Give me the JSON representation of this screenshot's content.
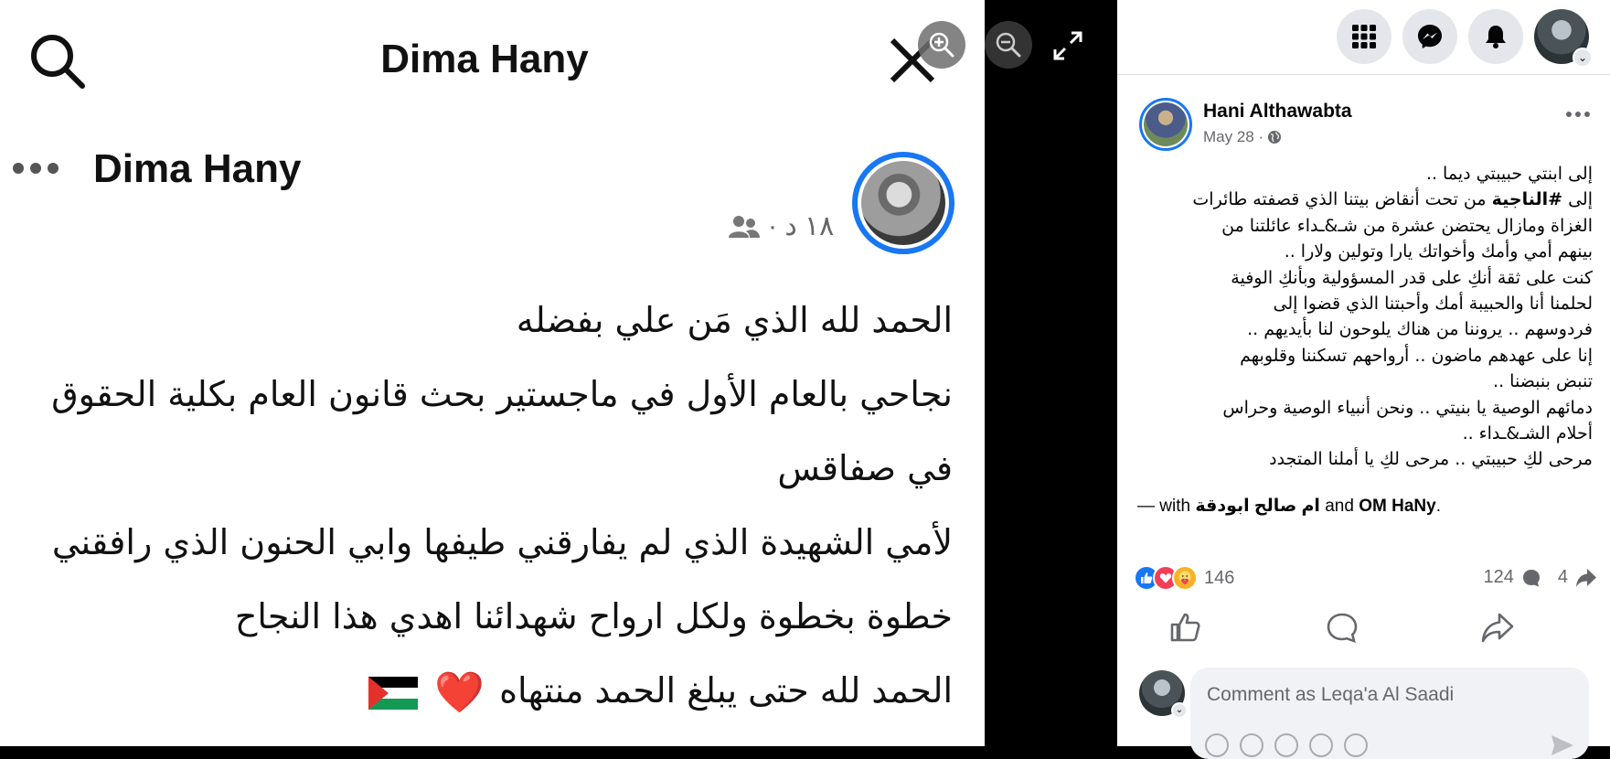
{
  "viewer": {
    "photo": {
      "header_title": "Dima Hany",
      "author_name": "Dima Hany",
      "meta": "١٨ د ·",
      "lines": [
        "الحمد لله الذي مَن علي بفضله",
        "نجاحي بالعام الأول في ماجستير بحث قانون العام بكلية الحقوق",
        "في صفاقس",
        " لأمي الشهيدة الذي لم يفارقني طيفها  وابي الحنون الذي رافقني",
        "خطوة بخطوة ولكل ارواح شهدائنا اهدي هذا النجاح",
        "الحمد لله حتى يبلغ الحمد منتهاه"
      ],
      "last_line_emoji": "❤️",
      "flag_colors": [
        "#000000",
        "#ffffff",
        "#149954",
        "#e4312b"
      ]
    },
    "controls": {
      "zoom_in": "zoom-in-icon",
      "zoom_out": "zoom-out-icon",
      "fullscreen": "fullscreen-icon"
    }
  },
  "topbar": {
    "menu_icon": "grid-menu-icon",
    "messenger_icon": "messenger-icon",
    "notifications_icon": "bell-icon",
    "profile_chevron": "⌄"
  },
  "post": {
    "author": "Hani Althawabta",
    "date": "May 28 ·",
    "text_lines": [
      {
        "pre": "إلى ابنتي حبيبتي ديما ..",
        "bold": "",
        "post": ""
      },
      {
        "pre": "إلى ",
        "bold": "#الناجية",
        "post": " من تحت أنقاض بيتنا الذي قصفته طائرات"
      },
      {
        "pre": "الغزاة ومازال يحتضن عشرة من شـ&ـداء عائلتنا من",
        "bold": "",
        "post": ""
      },
      {
        "pre": "بينهم أمي وأمك وأخواتك يارا وتولين ولارا ..",
        "bold": "",
        "post": ""
      },
      {
        "pre": "كنت على ثقة أنكِ على قدر المسؤولية وبأنكِ الوفية",
        "bold": "",
        "post": ""
      },
      {
        "pre": "لحلمنا أنا والحبيبة أمك وأحبتنا الذي قضوا إلى",
        "bold": "",
        "post": ""
      },
      {
        "pre": "فردوسهم .. يروننا من هناك يلوحون لنا بأيديهم ..",
        "bold": "",
        "post": ""
      },
      {
        "pre": "إنا على عهدهم ماضون .. أرواحهم تسكننا وقلوبهم",
        "bold": "",
        "post": ""
      },
      {
        "pre": "تنبض بنبضنا ..",
        "bold": "",
        "post": ""
      },
      {
        "pre": "دمائهم الوصية يا بنيتي .. ونحن أنبياء الوصية وحراس",
        "bold": "",
        "post": ""
      },
      {
        "pre": "أحلام الشـ&ـداء ..",
        "bold": "",
        "post": ""
      },
      {
        "pre": "مرحى لكِ حبيبتي .. مرحى لكِ يا أملنا المتجدد",
        "bold": "",
        "post": ""
      }
    ],
    "with_prefix": "— with ",
    "with_user1": "ام صالح ابودقة",
    "with_and": " and ",
    "with_user2": "OM HaNy",
    "with_suffix": ".",
    "reactions_count": "146",
    "comments_count": "124",
    "shares_count": "4",
    "reaction_icons": [
      "like",
      "love",
      "care"
    ],
    "comment_placeholder": "Comment as Leqa'a Al Saadi"
  },
  "colors": {
    "accent": "#1877f2",
    "secondary_text": "#65676b",
    "button_bg": "#e4e6eb"
  }
}
